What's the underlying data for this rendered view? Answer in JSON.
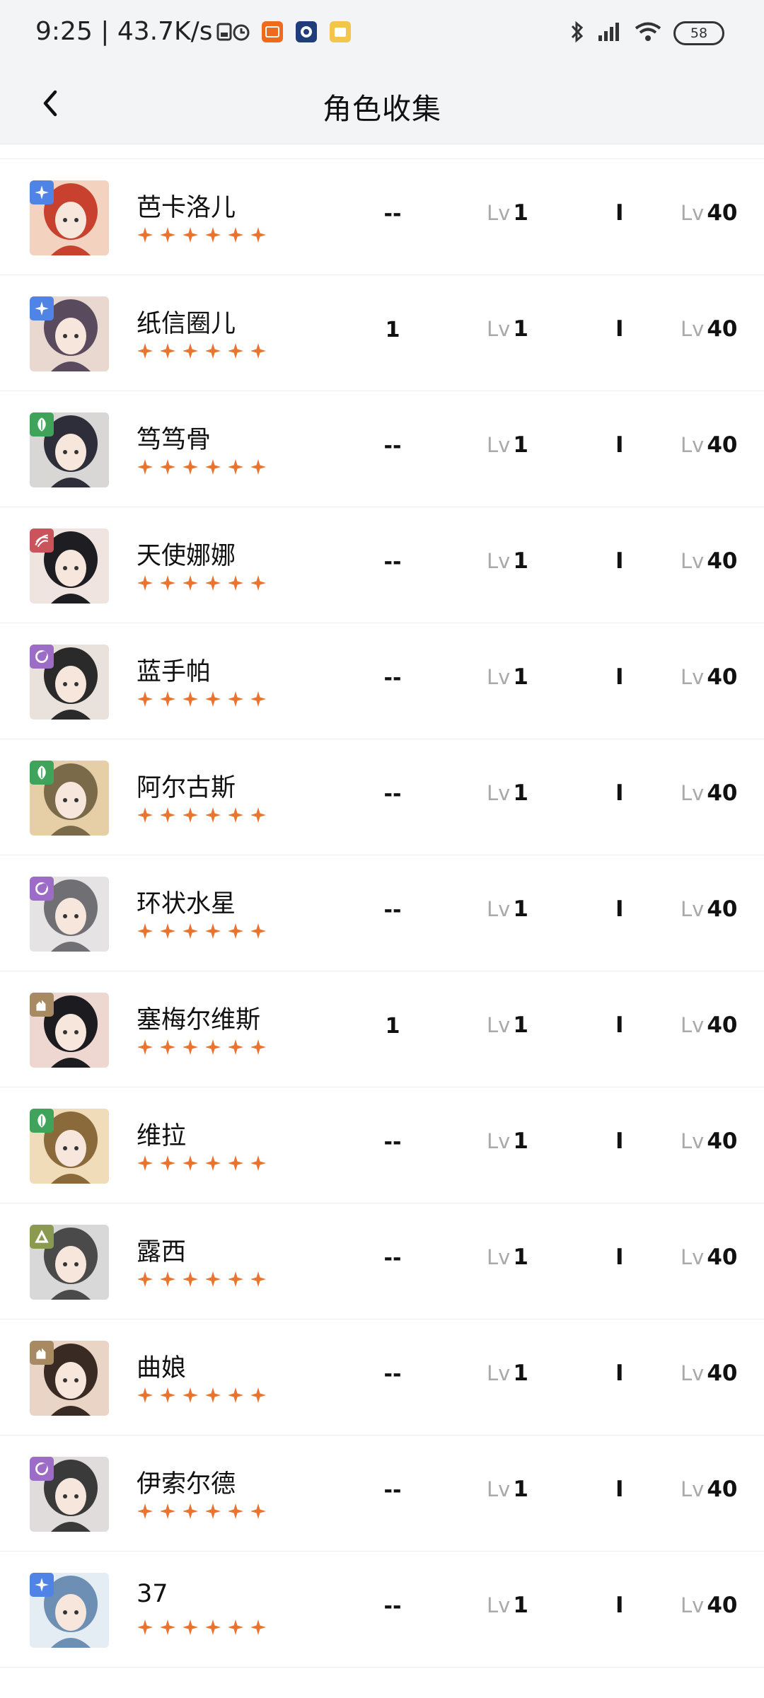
{
  "status_bar": {
    "time": "9:25 | 43.7K/s",
    "battery": "58",
    "icons": [
      "sim-icon",
      "alarm-icon",
      "mi-app-icon",
      "app-icon",
      "app-icon",
      "bluetooth-icon",
      "signal-icon",
      "wifi-icon",
      "battery-icon"
    ]
  },
  "header": {
    "title": "角色收集",
    "back_icon": "chevron-left-icon"
  },
  "colors": {
    "star": "#e8742f",
    "element_blue": "#4f83e6",
    "element_green": "#3fa35a",
    "element_red": "#c9545c",
    "element_purple": "#9c6cc6",
    "element_brown": "#a88a62",
    "element_olive": "#8a9a50"
  },
  "characters": [
    {
      "name": "芭卡洛儿",
      "stars": 6,
      "element": "blue",
      "element_icon": "star-element-icon",
      "count": "--",
      "lv_label": "Lv",
      "lv_value": "1",
      "rank": "I",
      "max_lv_label": "Lv",
      "max_lv_value": "40"
    },
    {
      "name": "纸信圈儿",
      "stars": 6,
      "element": "blue",
      "element_icon": "star-element-icon",
      "count": "1",
      "lv_label": "Lv",
      "lv_value": "1",
      "rank": "I",
      "max_lv_label": "Lv",
      "max_lv_value": "40"
    },
    {
      "name": "笃笃骨",
      "stars": 6,
      "element": "green",
      "element_icon": "leaf-element-icon",
      "count": "--",
      "lv_label": "Lv",
      "lv_value": "1",
      "rank": "I",
      "max_lv_label": "Lv",
      "max_lv_value": "40"
    },
    {
      "name": "天使娜娜",
      "stars": 6,
      "element": "red",
      "element_icon": "wave-element-icon",
      "count": "--",
      "lv_label": "Lv",
      "lv_value": "1",
      "rank": "I",
      "max_lv_label": "Lv",
      "max_lv_value": "40"
    },
    {
      "name": "蓝手帕",
      "stars": 6,
      "element": "purple",
      "element_icon": "moon-element-icon",
      "count": "--",
      "lv_label": "Lv",
      "lv_value": "1",
      "rank": "I",
      "max_lv_label": "Lv",
      "max_lv_value": "40"
    },
    {
      "name": "阿尔古斯",
      "stars": 6,
      "element": "green",
      "element_icon": "leaf-element-icon",
      "count": "--",
      "lv_label": "Lv",
      "lv_value": "1",
      "rank": "I",
      "max_lv_label": "Lv",
      "max_lv_value": "40"
    },
    {
      "name": "环状水星",
      "stars": 6,
      "element": "purple",
      "element_icon": "moon-element-icon",
      "count": "--",
      "lv_label": "Lv",
      "lv_value": "1",
      "rank": "I",
      "max_lv_label": "Lv",
      "max_lv_value": "40"
    },
    {
      "name": "塞梅尔维斯",
      "stars": 6,
      "element": "brown",
      "element_icon": "beast-element-icon",
      "count": "1",
      "lv_label": "Lv",
      "lv_value": "1",
      "rank": "I",
      "max_lv_label": "Lv",
      "max_lv_value": "40"
    },
    {
      "name": "维拉",
      "stars": 6,
      "element": "green",
      "element_icon": "leaf-element-icon",
      "count": "--",
      "lv_label": "Lv",
      "lv_value": "1",
      "rank": "I",
      "max_lv_label": "Lv",
      "max_lv_value": "40"
    },
    {
      "name": "露西",
      "stars": 6,
      "element": "olive",
      "element_icon": "mineral-element-icon",
      "count": "--",
      "lv_label": "Lv",
      "lv_value": "1",
      "rank": "I",
      "max_lv_label": "Lv",
      "max_lv_value": "40"
    },
    {
      "name": "曲娘",
      "stars": 6,
      "element": "brown",
      "element_icon": "beast-element-icon",
      "count": "--",
      "lv_label": "Lv",
      "lv_value": "1",
      "rank": "I",
      "max_lv_label": "Lv",
      "max_lv_value": "40"
    },
    {
      "name": "伊索尔德",
      "stars": 6,
      "element": "purple",
      "element_icon": "moon-element-icon",
      "count": "--",
      "lv_label": "Lv",
      "lv_value": "1",
      "rank": "I",
      "max_lv_label": "Lv",
      "max_lv_value": "40"
    },
    {
      "name": "37",
      "stars": 6,
      "element": "blue",
      "element_icon": "star-element-icon",
      "count": "--",
      "lv_label": "Lv",
      "lv_value": "1",
      "rank": "I",
      "max_lv_label": "Lv",
      "max_lv_value": "40"
    }
  ]
}
